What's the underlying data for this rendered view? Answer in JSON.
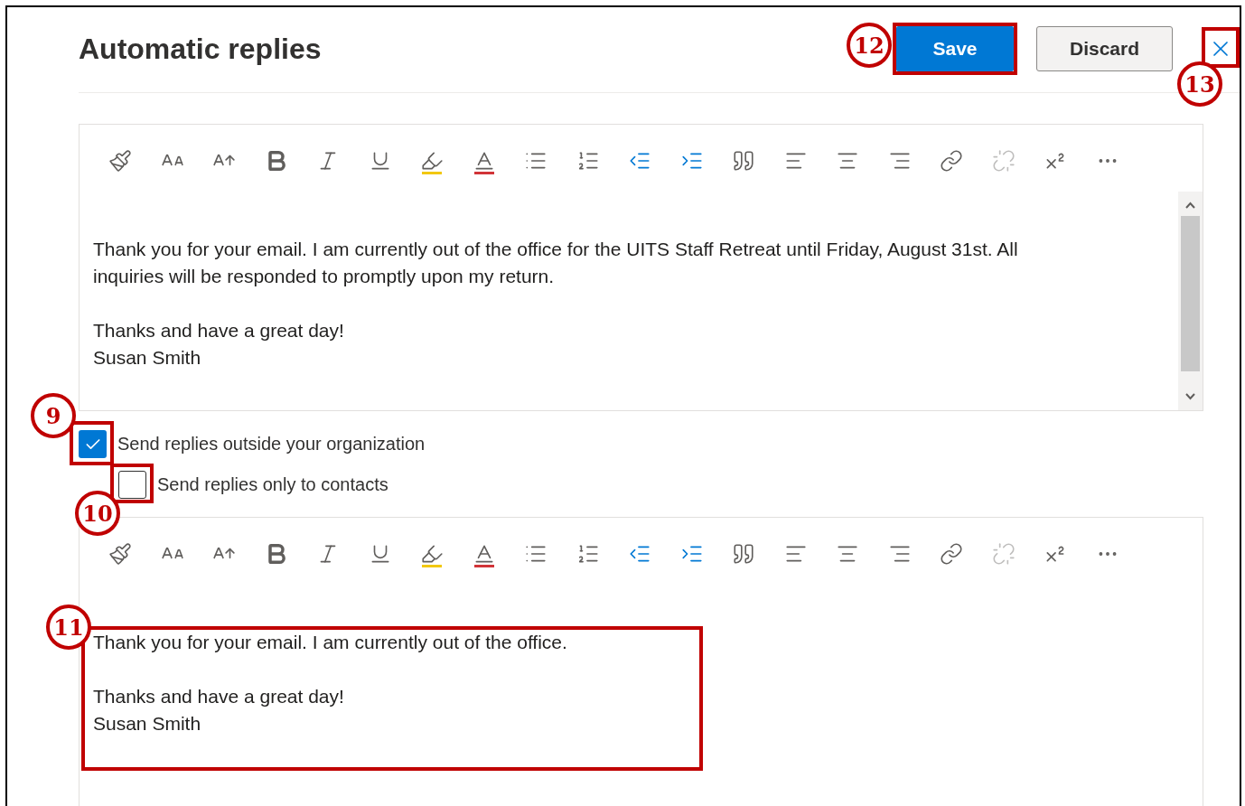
{
  "header": {
    "title": "Automatic replies",
    "save_button": {
      "label": "Save",
      "callout": "12"
    },
    "discard_button": {
      "label": "Discard"
    },
    "close_button": {
      "callout": "13"
    }
  },
  "reply_editor": {
    "toolbar": [
      {
        "kind": "format-painter",
        "disabled": false
      },
      {
        "kind": "font-size",
        "disabled": false
      },
      {
        "kind": "grow-font",
        "disabled": false
      },
      {
        "kind": "bold",
        "disabled": false
      },
      {
        "kind": "italic",
        "disabled": false
      },
      {
        "kind": "underline",
        "disabled": false
      },
      {
        "kind": "highlight",
        "disabled": false
      },
      {
        "kind": "font-color",
        "disabled": false
      },
      {
        "kind": "bullets",
        "disabled": false
      },
      {
        "kind": "numbering",
        "disabled": false
      },
      {
        "kind": "outdent",
        "disabled": false
      },
      {
        "kind": "indent",
        "disabled": false
      },
      {
        "kind": "quote",
        "disabled": false
      },
      {
        "kind": "align-left",
        "disabled": false
      },
      {
        "kind": "align-center",
        "disabled": false
      },
      {
        "kind": "align-right",
        "disabled": false
      },
      {
        "kind": "link",
        "disabled": false
      },
      {
        "kind": "unlink",
        "disabled": true
      },
      {
        "kind": "superscript",
        "disabled": false
      },
      {
        "kind": "more",
        "disabled": false
      }
    ],
    "paragraphs": [
      {
        "lines": [
          "Thank you for your email. I am currently out of the office for the UITS Staff Retreat until Friday, August 31st. All inquiries will be responded to promptly upon my return."
        ]
      },
      {
        "lines": [
          "Thanks and have a great day!",
          "Susan Smith"
        ]
      }
    ]
  },
  "options": [
    {
      "label": "Send replies outside your organization",
      "checked": true,
      "callout": "9",
      "children": [
        {
          "label": "Send replies only to contacts",
          "checked": false,
          "callout": "10"
        }
      ]
    }
  ],
  "external_editor": {
    "toolbar": [
      {
        "kind": "format-painter",
        "disabled": false
      },
      {
        "kind": "font-size",
        "disabled": false
      },
      {
        "kind": "grow-font",
        "disabled": false
      },
      {
        "kind": "bold",
        "disabled": false
      },
      {
        "kind": "italic",
        "disabled": false
      },
      {
        "kind": "underline",
        "disabled": false
      },
      {
        "kind": "highlight",
        "disabled": false
      },
      {
        "kind": "font-color",
        "disabled": false
      },
      {
        "kind": "bullets",
        "disabled": false
      },
      {
        "kind": "numbering",
        "disabled": false
      },
      {
        "kind": "outdent",
        "disabled": false
      },
      {
        "kind": "indent",
        "disabled": false
      },
      {
        "kind": "quote",
        "disabled": false
      },
      {
        "kind": "align-left",
        "disabled": false
      },
      {
        "kind": "align-center",
        "disabled": false
      },
      {
        "kind": "align-right",
        "disabled": false
      },
      {
        "kind": "link",
        "disabled": false
      },
      {
        "kind": "unlink",
        "disabled": true
      },
      {
        "kind": "superscript",
        "disabled": false
      },
      {
        "kind": "more",
        "disabled": false
      }
    ],
    "paragraphs": [
      {
        "lines": [
          "Thank you for your email. I am currently out of the office."
        ]
      },
      {
        "lines": [
          "Thanks and have a great day!",
          "Susan Smith"
        ]
      }
    ],
    "callout": "11"
  }
}
